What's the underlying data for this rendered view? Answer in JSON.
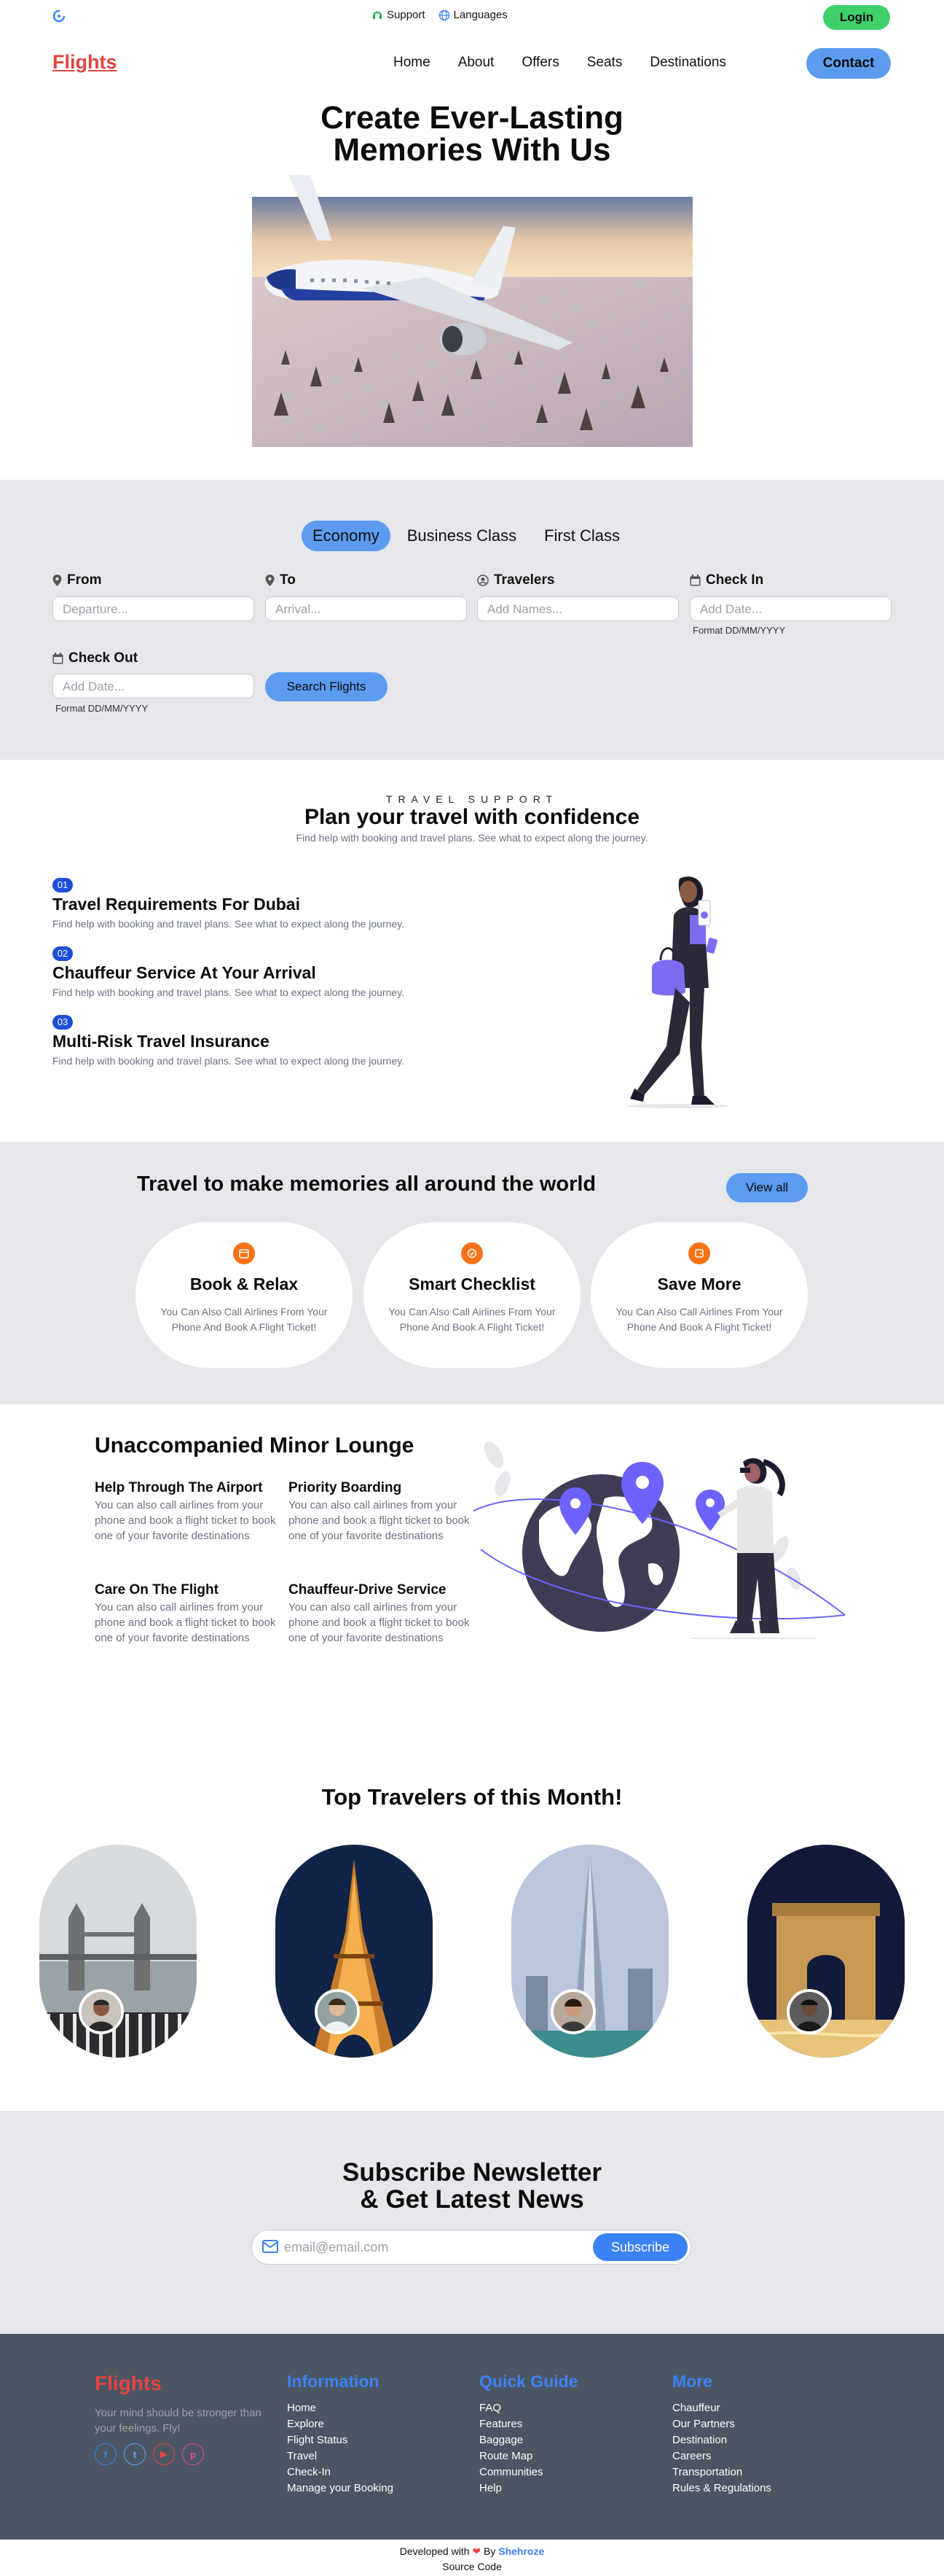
{
  "topbar": {
    "support_label": "Support",
    "languages_label": "Languages",
    "login_label": "Login"
  },
  "nav": {
    "brand": "Flights",
    "items": [
      "Home",
      "About",
      "Offers",
      "Seats",
      "Destinations"
    ],
    "contact_label": "Contact"
  },
  "hero": {
    "title_line1": "Create Ever-Lasting",
    "title_line2": "Memories With Us"
  },
  "booking": {
    "classes": [
      "Economy",
      "Business Class",
      "First Class"
    ],
    "active_class": "Economy",
    "fields": {
      "from_label": "From",
      "from_placeholder": "Departure...",
      "to_label": "To",
      "to_placeholder": "Arrival...",
      "travelers_label": "Travelers",
      "travelers_placeholder": "Add Names...",
      "checkin_label": "Check In",
      "checkin_placeholder": "Add Date...",
      "checkin_hint": "Format DD/MM/YYYY",
      "checkout_label": "Check Out",
      "checkout_placeholder": "Add Date...",
      "checkout_hint": "Format DD/MM/YYYY"
    },
    "search_label": "Search Flights"
  },
  "support": {
    "kicker": "TRAVEL SUPPORT",
    "title": "Plan your travel with confidence",
    "subtitle": "Find help with booking and travel plans. See what to expect along the journey.",
    "items": [
      {
        "num": "01",
        "title": "Travel Requirements For Dubai",
        "text": "Find help with booking and travel plans. See what to expect along the journey."
      },
      {
        "num": "02",
        "title": "Chauffeur Service At Your Arrival",
        "text": "Find help with booking and travel plans. See what to expect along the journey."
      },
      {
        "num": "03",
        "title": "Multi-Risk Travel Insurance",
        "text": "Find help with booking and travel plans. See what to expect along the journey."
      }
    ]
  },
  "memories": {
    "title": "Travel to make memories all around the world",
    "view_all_label": "View all",
    "cards": [
      {
        "title": "Book & Relax",
        "text": "You Can Also Call Airlines From Your Phone And Book A Flight Ticket!",
        "icon": "calendar-icon"
      },
      {
        "title": "Smart Checklist",
        "text": "You Can Also Call Airlines From Your Phone And Book A Flight Ticket!",
        "icon": "check-circle-icon"
      },
      {
        "title": "Save More",
        "text": "You Can Also Call Airlines From Your Phone And Book A Flight Ticket!",
        "icon": "wallet-icon"
      }
    ]
  },
  "lounge": {
    "title": "Unaccompanied Minor Lounge",
    "items": [
      {
        "title": "Help Through The Airport",
        "text": "You can also call airlines from your phone and book a flight ticket to book one of your favorite destinations"
      },
      {
        "title": "Priority Boarding",
        "text": "You can also call airlines from your phone and book a flight ticket to book one of your favorite destinations"
      },
      {
        "title": "Care On The Flight",
        "text": "You can also call airlines from your phone and book a flight ticket to book one of your favorite destinations"
      },
      {
        "title": "Chauffeur-Drive Service",
        "text": "You can also call airlines from your phone and book a flight ticket to book one of your favorite destinations"
      }
    ]
  },
  "travelers": {
    "title": "Top Travelers of this Month!",
    "cards": [
      {
        "place": "london-tower-bridge"
      },
      {
        "place": "eiffel-tower"
      },
      {
        "place": "burj-khalifa"
      },
      {
        "place": "arc-de-triomphe"
      }
    ]
  },
  "newsletter": {
    "title_line1": "Subscribe Newsletter",
    "title_line2": "& Get Latest News",
    "placeholder": "email@email.com",
    "button_label": "Subscribe"
  },
  "footer": {
    "brand": "Flights",
    "tagline": "Your mind should be stronger than your feelings. Fly!",
    "columns": [
      {
        "heading": "Information",
        "links": [
          "Home",
          "Explore",
          "Flight Status",
          "Travel",
          "Check-In",
          "Manage your Booking"
        ]
      },
      {
        "heading": "Quick Guide",
        "links": [
          "FAQ",
          "Features",
          "Baggage",
          "Route Map",
          "Communities",
          "Help"
        ]
      },
      {
        "heading": "More",
        "links": [
          "Chauffeur",
          "Our Partners",
          "Destination",
          "Careers",
          "Transportation",
          "Rules & Regulations"
        ]
      }
    ],
    "developed_prefix": "Developed with",
    "developed_by": "By",
    "author": "Shehroze",
    "source_label": "Source Code"
  },
  "colors": {
    "brand_red": "#e2453e",
    "accent_blue": "#5b9cf0",
    "login_green": "#3fd06a",
    "footer_bg": "#4b5563",
    "section_gray": "#e5e7eb",
    "orange": "#f97316"
  }
}
